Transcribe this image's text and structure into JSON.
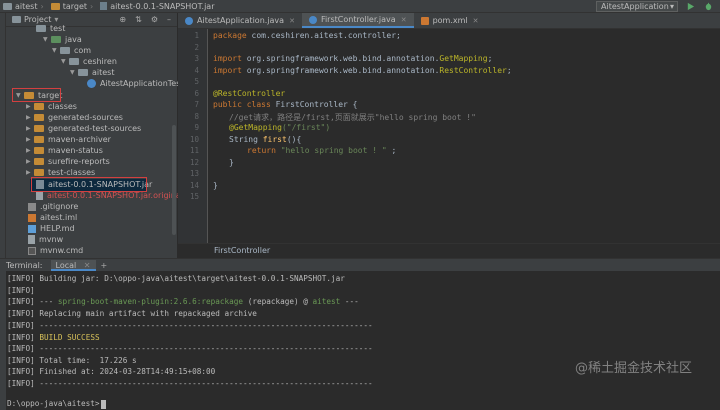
{
  "topbar": {
    "crumbs": [
      "aitest",
      "target",
      "aitest-0.0.1-SNAPSHOT.jar"
    ],
    "run_config": "AitestApplication"
  },
  "project_panel": {
    "title": "Project",
    "tree": [
      {
        "label": "test",
        "icon": "folder-icon",
        "kind": "folder"
      },
      {
        "label": "java",
        "icon": "folder-icon",
        "kind": "folder-green"
      },
      {
        "label": "com",
        "icon": "folder-icon",
        "kind": "folder"
      },
      {
        "label": "ceshiren",
        "icon": "folder-icon",
        "kind": "folder"
      },
      {
        "label": "aitest",
        "icon": "folder-icon",
        "kind": "folder"
      },
      {
        "label": "AitestApplicationTest",
        "icon": "test-class-icon",
        "kind": "test"
      },
      {
        "label": "target",
        "icon": "folder-icon",
        "kind": "folder-orange"
      },
      {
        "label": "classes",
        "icon": "folder-icon",
        "kind": "folder-orange"
      },
      {
        "label": "generated-sources",
        "icon": "folder-icon",
        "kind": "folder-orange"
      },
      {
        "label": "generated-test-sources",
        "icon": "folder-icon",
        "kind": "folder-orange"
      },
      {
        "label": "maven-archiver",
        "icon": "folder-icon",
        "kind": "folder-orange"
      },
      {
        "label": "maven-status",
        "icon": "folder-icon",
        "kind": "folder-orange"
      },
      {
        "label": "surefire-reports",
        "icon": "folder-icon",
        "kind": "folder-orange"
      },
      {
        "label": "test-classes",
        "icon": "folder-icon",
        "kind": "folder-orange"
      },
      {
        "label": "aitest-0.0.1-SNAPSHOT.jar",
        "icon": "jar-icon",
        "kind": "jar"
      },
      {
        "label": "aitest-0.0.1-SNAPSHOT.jar.original",
        "icon": "file-icon",
        "kind": "file-red"
      },
      {
        "label": ".gitignore",
        "icon": "git-icon",
        "kind": "file"
      },
      {
        "label": "aitest.iml",
        "icon": "iml-icon",
        "kind": "file"
      },
      {
        "label": "HELP.md",
        "icon": "md-icon",
        "kind": "file"
      },
      {
        "label": "mvnw",
        "icon": "file-icon",
        "kind": "file"
      },
      {
        "label": "mvnw.cmd",
        "icon": "cmd-icon",
        "kind": "file"
      }
    ]
  },
  "editor": {
    "tabs": [
      {
        "label": "AitestApplication.java",
        "active": false
      },
      {
        "label": "FirstController.java",
        "active": true
      },
      {
        "label": "pom.xml",
        "active": false
      }
    ],
    "line_numbers": [
      "1",
      "2",
      "3",
      "4",
      "5",
      "6",
      "7",
      "8",
      "9",
      "10",
      "11",
      "12",
      "13",
      "14",
      "15"
    ],
    "code": {
      "l1": [
        "package",
        " com.ceshiren.aitest.controller;"
      ],
      "l3": [
        "import",
        " org.springframework.web.bind.annotation.",
        "GetMapping",
        ";"
      ],
      "l4": [
        "import",
        " org.springframework.web.bind.annotation.",
        "RestController",
        ";"
      ],
      "l6": "@RestController",
      "l7": [
        "public class",
        " FirstController {"
      ],
      "l8": "//get请求，路径是/first,页面就展示\"hello spring boot !\"",
      "l9": [
        "@GetMapping",
        "(\"/first\")"
      ],
      "l10": [
        "String ",
        "first",
        "(){"
      ],
      "l11": [
        "return ",
        "\"hello spring boot ! \"",
        " ;"
      ],
      "l12": "}",
      "l14": "}"
    },
    "breadcrumb": "FirstController"
  },
  "terminal": {
    "title": "Terminal:",
    "tab": "Local",
    "lines": [
      "[INFO] Building jar: D:\\oppo-java\\aitest\\target\\aitest-0.0.1-SNAPSHOT.jar",
      "[INFO]",
      [
        "[INFO] --- ",
        "spring-boot-maven-plugin:2.6.6:repackage",
        " (repackage) @ ",
        "aitest",
        " ---"
      ],
      "[INFO] Replacing main artifact with repackaged archive",
      "[INFO] ------------------------------------------------------------------------",
      [
        "[INFO] ",
        "BUILD SUCCESS"
      ],
      "[INFO] ------------------------------------------------------------------------",
      "[INFO] Total time:  17.226 s",
      "[INFO] Finished at: 2024-03-28T14:49:15+08:00",
      "[INFO] ------------------------------------------------------------------------",
      "D:\\oppo-java\\aitest>"
    ]
  },
  "watermark": "@稀土掘金技术社区",
  "colors": {
    "background": "#2b2b2b",
    "panel": "#3c3f41",
    "keyword": "#cc7832",
    "annotation": "#bbb529",
    "string": "#6a8759",
    "comment": "#808080",
    "highlight_box": "#d34040",
    "success": "#d7c15a"
  }
}
